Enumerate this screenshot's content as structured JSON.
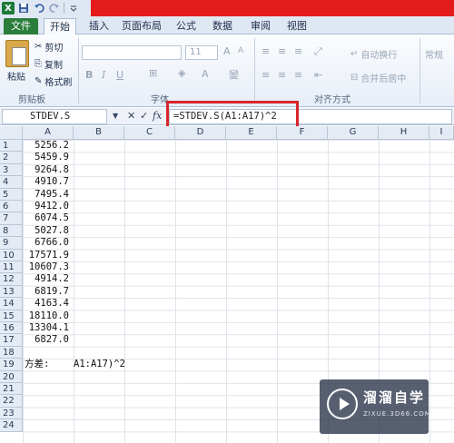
{
  "quick_access": {
    "excel_icon": "X",
    "save_icon": "save-icon",
    "undo_icon": "undo-icon",
    "redo_icon": "redo-icon"
  },
  "ribbon": {
    "tabs": [
      "文件",
      "开始",
      "插入",
      "页面布局",
      "公式",
      "数据",
      "审阅",
      "视图"
    ],
    "clipboard": {
      "paste": "粘贴",
      "cut": "剪切",
      "copy": "复制",
      "format_painter": "格式刷",
      "group_label": "剪贴板"
    },
    "font": {
      "size": "11",
      "bold": "B",
      "italic": "I",
      "underline": "U",
      "group_label": "字体"
    },
    "alignment": {
      "wrap_text": "自动换行",
      "merge_center": "合并后居中",
      "group_label": "对齐方式"
    },
    "number": {
      "format": "常规"
    }
  },
  "formula_bar": {
    "name_box": "STDEV.S",
    "cancel": "✕",
    "enter": "✓",
    "fx": "fx",
    "formula": "=STDEV.S(A1:A17)^2"
  },
  "grid": {
    "columns": [
      "A",
      "B",
      "C",
      "D",
      "E",
      "F",
      "G",
      "H",
      "I"
    ],
    "rows": [
      "1",
      "2",
      "3",
      "4",
      "5",
      "6",
      "7",
      "8",
      "9",
      "10",
      "11",
      "12",
      "13",
      "14",
      "15",
      "16",
      "17",
      "18",
      "19",
      "20",
      "21",
      "22",
      "23",
      "24"
    ],
    "column_a_values": [
      "5256.2",
      "5459.9",
      "9264.8",
      "4910.7",
      "7495.4",
      "9412.0",
      "6074.5",
      "5027.8",
      "6766.0",
      "17571.9",
      "10607.3",
      "4914.2",
      "6819.7",
      "4163.4",
      "18110.0",
      "13304.1",
      "6827.0"
    ],
    "a19": "方差:",
    "b19": "A1:A17)^2"
  },
  "watermark": {
    "title": "溜溜自学",
    "subtitle": "ZIXUE.3D66.COM"
  }
}
